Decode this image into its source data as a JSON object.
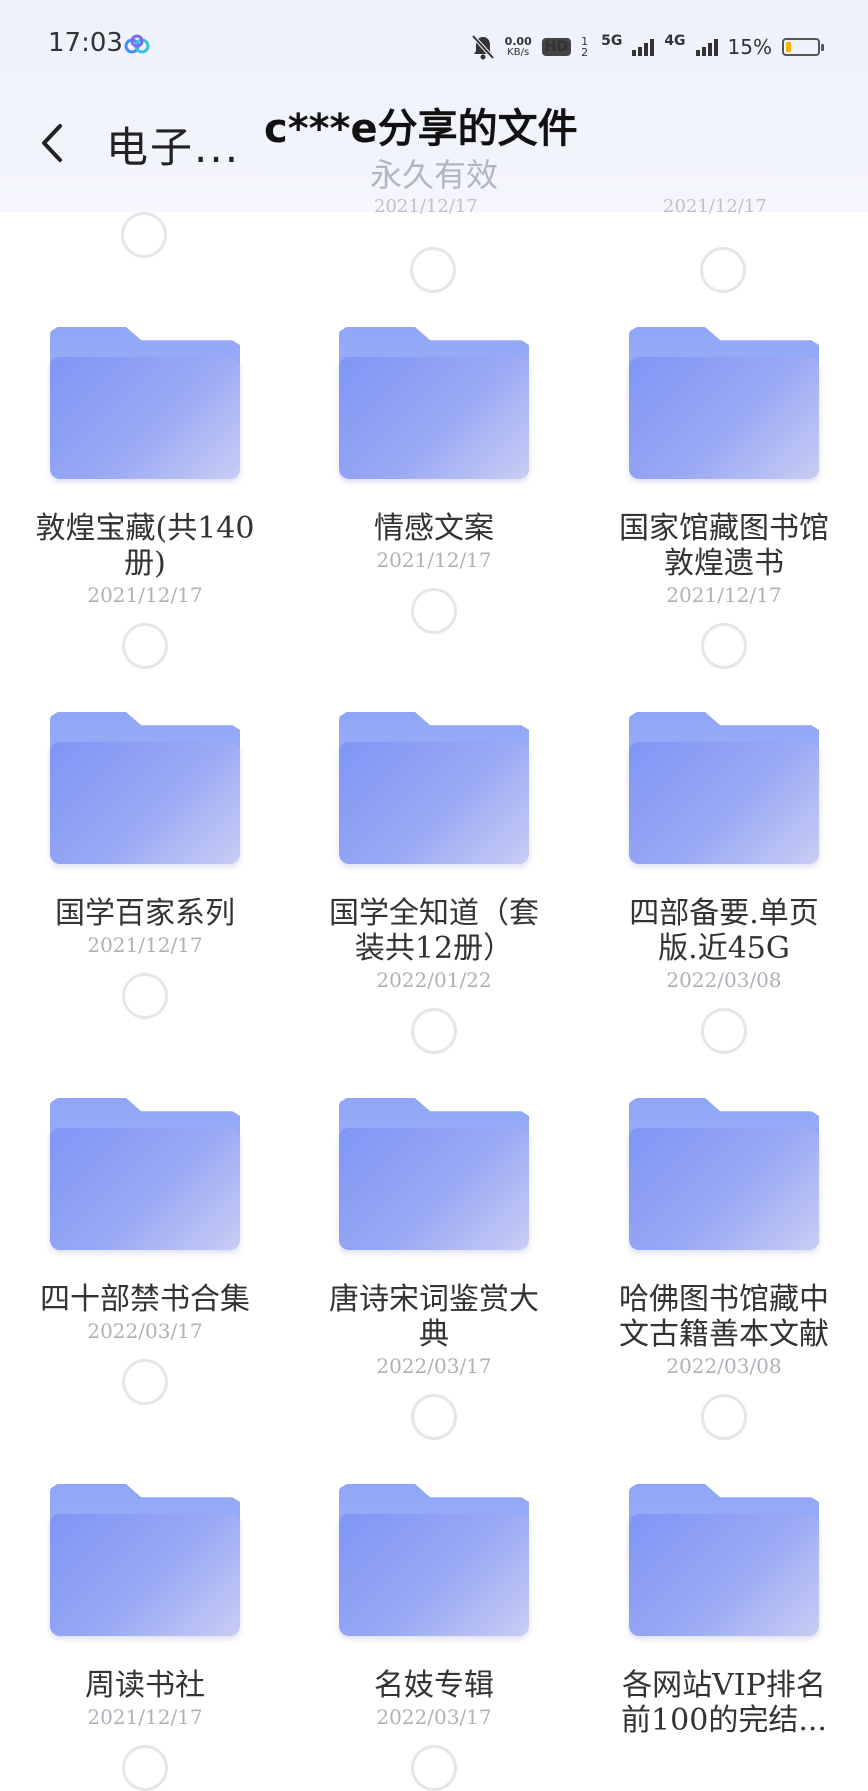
{
  "status_bar": {
    "time": "17:03",
    "speed_value": "0.00",
    "speed_unit": "KB/s",
    "hd": "HD",
    "sim": "1 2",
    "net1": "5G",
    "net2": "4G",
    "battery": "15%",
    "battery_level": 0.15,
    "battery_color": "#f2b400"
  },
  "header": {
    "breadcrumb": "电子...",
    "title": "c***e分享的文件",
    "subtitle": "永久有效",
    "peek_dates": [
      "2021/12/17",
      "2021/12/17"
    ]
  },
  "folders": [
    {
      "name_lines": [
        "敦煌宝藏(共140",
        "册)"
      ],
      "date": "2021/12/17"
    },
    {
      "name_lines": [
        "情感文案"
      ],
      "date": "2021/12/17"
    },
    {
      "name_lines": [
        "国家馆藏图书馆",
        "敦煌遗书"
      ],
      "date": "2021/12/17"
    },
    {
      "name_lines": [
        "国学百家系列"
      ],
      "date": "2021/12/17"
    },
    {
      "name_lines": [
        "国学全知道（套",
        "装共12册）"
      ],
      "date": "2022/01/22"
    },
    {
      "name_lines": [
        "四部备要.单页",
        "版.近45G"
      ],
      "date": "2022/03/08"
    },
    {
      "name_lines": [
        "四十部禁书合集"
      ],
      "date": "2022/03/17"
    },
    {
      "name_lines": [
        "唐诗宋词鉴赏大",
        "典"
      ],
      "date": "2022/03/17"
    },
    {
      "name_lines": [
        "哈佛图书馆藏中",
        "文古籍善本文献"
      ],
      "date": "2022/03/08"
    },
    {
      "name_lines": [
        "周读书社"
      ],
      "date": "2021/12/17"
    },
    {
      "name_lines": [
        "名妓专辑"
      ],
      "date": "2022/03/17"
    },
    {
      "name_lines": [
        "各网站VIP排名",
        "前100的完结..."
      ],
      "date": ""
    }
  ]
}
